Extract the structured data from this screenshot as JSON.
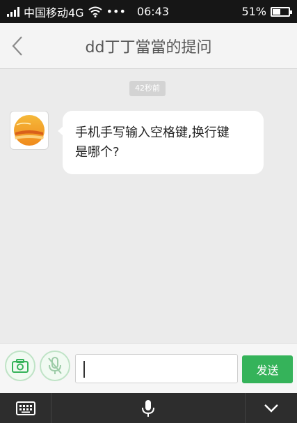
{
  "status_bar": {
    "carrier": "中国移动4G",
    "dots": "•••",
    "time": "06:43",
    "battery_percent": "51%",
    "battery_level": 0.51
  },
  "header": {
    "title": "dd丁丁當當的提问"
  },
  "chat": {
    "timestamp": "42秒前",
    "message": {
      "line1": "手机手写输入空格键,换行键",
      "line2": "是哪个?"
    }
  },
  "input": {
    "value": "",
    "send_label": "发送"
  },
  "icons": {
    "back": "back-arrow-icon",
    "camera": "camera-icon",
    "mic": "mic-off-icon",
    "keyboard": "keyboard-icon",
    "voice": "microphone-icon",
    "collapse": "chevron-down-icon"
  },
  "colors": {
    "accent": "#35b35a",
    "status_bar": "#161616",
    "keyboard_bar": "#2d2d2d"
  }
}
